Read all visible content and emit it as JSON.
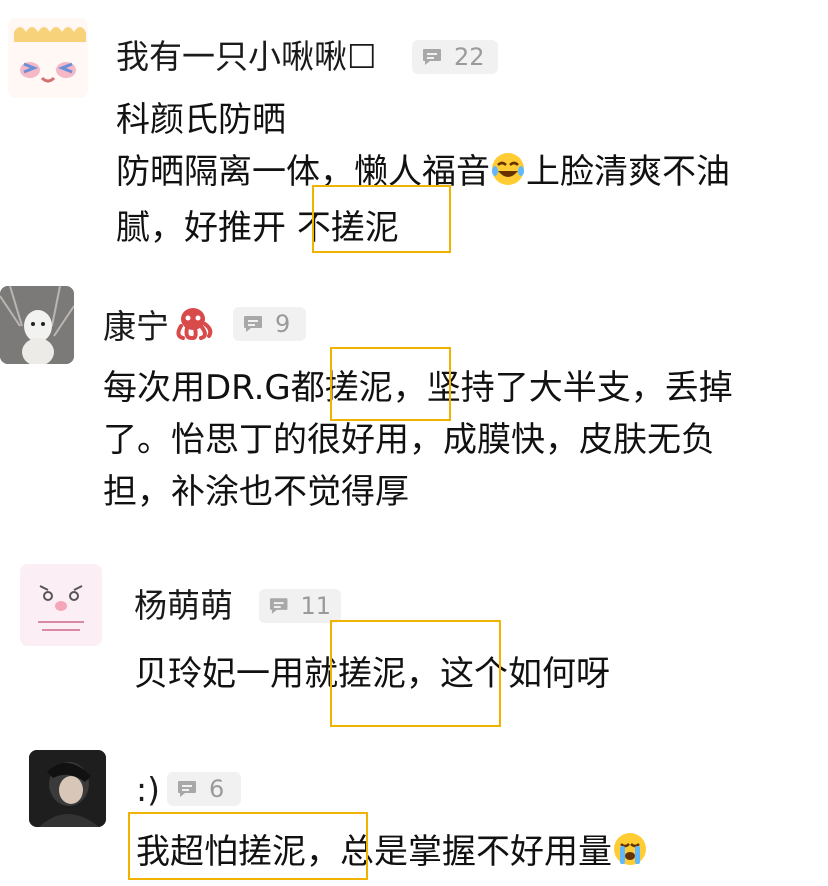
{
  "colors": {
    "highlight": "#f0b400",
    "badge_bg": "#f1f1f1",
    "badge_text": "#9a9a9a"
  },
  "comments": [
    {
      "username": "我有一只小啾啾☐",
      "reply_count": "22",
      "lines": [
        "科颜氏防晒",
        "防晒隔离一体，懒人福音",
        "上脸清爽不油",
        "腻，好推开",
        "不搓泥"
      ],
      "emoji": "joy-tears-emoji"
    },
    {
      "username": "康宁",
      "reply_count": "9",
      "emoji": "octopus-emoji",
      "lines": [
        "每次用DR.G",
        "都搓泥，",
        "坚持了大半支，丢掉",
        "了。怡思丁的很好用，成膜快，皮肤无负",
        "担，补涂也不觉得厚"
      ]
    },
    {
      "username": "杨萌萌",
      "reply_count": "11",
      "lines": [
        "贝玲妃一用",
        "就搓泥，",
        "这个如何呀"
      ]
    },
    {
      "username": ":)",
      "reply_count": "6",
      "emoji": "crying-emoji",
      "lines": [
        "我超怕搓泥，",
        "总是掌握不好用量"
      ]
    }
  ]
}
